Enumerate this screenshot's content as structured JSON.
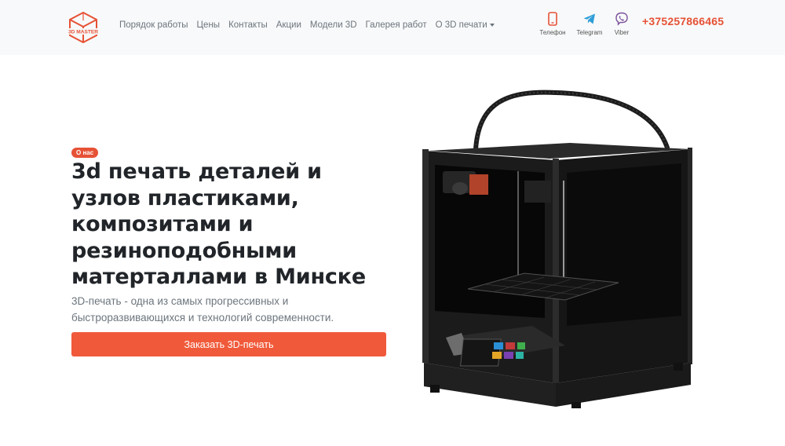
{
  "brand": {
    "logo_text": "3D MASTER"
  },
  "nav": {
    "items": [
      "Порядок работы",
      "Цены",
      "Контакты",
      "Акции",
      "Модели 3D",
      "Галерея работ"
    ],
    "dropdown_label": "О 3D печати"
  },
  "contacts": [
    {
      "label": "Телефон",
      "icon": "mobile-phone-icon"
    },
    {
      "label": "Telegram",
      "icon": "telegram-icon"
    },
    {
      "label": "Viber",
      "icon": "viber-icon"
    }
  ],
  "phone": "+375257866465",
  "hero": {
    "badge": "О нас",
    "title_lines": [
      "3d печать деталей и",
      "узлов пластиками,",
      "композитами и",
      "резиноподобными",
      "матерталлами в Минске"
    ],
    "subtitle_lines": [
      "3D-печать - одна из самых прогрессивных и",
      "быстроразвивающихся и технологий современности."
    ],
    "cta_label": "Заказать 3D-печать"
  },
  "printer_screen_colors": [
    "#2b8fd6",
    "#c23a3a",
    "#3fae4d",
    "#e2a526",
    "#7a3fb0",
    "#2bb3a3"
  ],
  "colors": {
    "accent": "#e65236",
    "button": "#f05a3a",
    "telegram": "#2f9ed8",
    "viber": "#7b519d"
  }
}
